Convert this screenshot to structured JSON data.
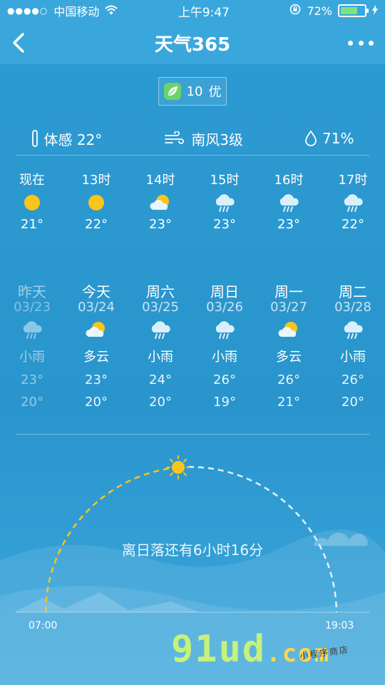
{
  "status": {
    "signal": "●●●●○",
    "carrier": "中国移动",
    "time": "上午9:47",
    "battery_percent": "72%",
    "battery_level": 0.72
  },
  "nav": {
    "title": "天气365"
  },
  "aqi": {
    "value": "10",
    "level": "优"
  },
  "stats": {
    "feels_like": "体感 22°",
    "wind": "南风3级",
    "humidity": "71%"
  },
  "hourly": [
    {
      "label": "现在",
      "icon": "sun-icon",
      "temp": "21°"
    },
    {
      "label": "13时",
      "icon": "sun-icon",
      "temp": "22°"
    },
    {
      "label": "14时",
      "icon": "partly-cloudy-icon",
      "temp": "23°"
    },
    {
      "label": "15时",
      "icon": "rain-cloud-icon",
      "temp": "23°"
    },
    {
      "label": "16时",
      "icon": "rain-cloud-icon",
      "temp": "23°"
    },
    {
      "label": "17时",
      "icon": "rain-cloud-icon",
      "temp": "22°"
    }
  ],
  "daily": [
    {
      "name": "昨天",
      "date": "03/23",
      "icon": "rain-cloud-icon",
      "cond": "小雨",
      "hi": "23°",
      "lo": "20°"
    },
    {
      "name": "今天",
      "date": "03/24",
      "icon": "partly-cloudy-icon",
      "cond": "多云",
      "hi": "23°",
      "lo": "20°"
    },
    {
      "name": "周六",
      "date": "03/25",
      "icon": "rain-cloud-icon",
      "cond": "小雨",
      "hi": "24°",
      "lo": "20°"
    },
    {
      "name": "周日",
      "date": "03/26",
      "icon": "rain-cloud-icon",
      "cond": "小雨",
      "hi": "26°",
      "lo": "19°"
    },
    {
      "name": "周一",
      "date": "03/27",
      "icon": "partly-cloudy-icon",
      "cond": "多云",
      "hi": "26°",
      "lo": "21°"
    },
    {
      "name": "周二",
      "date": "03/28",
      "icon": "rain-cloud-icon",
      "cond": "小雨",
      "hi": "26°",
      "lo": "20°"
    }
  ],
  "sun": {
    "sunset_remaining": "离日落还有6小时16分",
    "sunrise": "07:00",
    "sunset": "19:03"
  },
  "watermark": {
    "brand": "91ud",
    "domain": ".com",
    "tagline": "小程序商店"
  },
  "colors": {
    "background": "#2f9fd6",
    "sun": "#f9c51a",
    "leaf": "#6bd36b"
  }
}
